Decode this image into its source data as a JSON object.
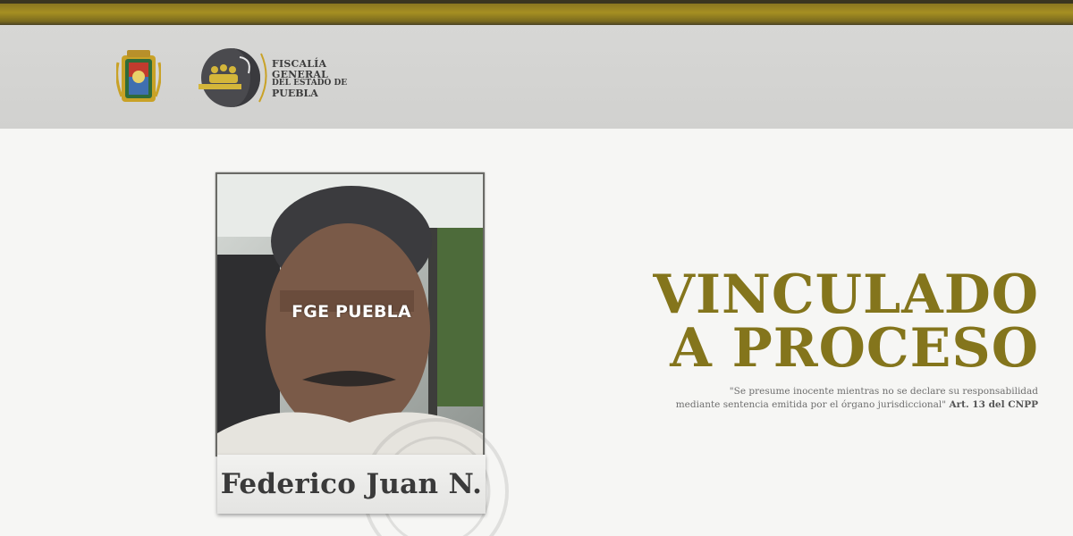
{
  "header": {
    "agency_line1": "FISCALÍA GENERAL",
    "agency_line2": "DEL ESTADO DE",
    "agency_line3": "PUEBLA",
    "seal_icon": "state-coat-of-arms-icon",
    "logo_icon": "fge-logo-icon"
  },
  "photo": {
    "overlay_text": "FGE PUEBLA"
  },
  "person": {
    "name": "Federico Juan N."
  },
  "headline": {
    "line1": "VINCULADO",
    "line2": "A PROCESO"
  },
  "notice": {
    "quote_line1": "\"Se presume inocente mientras no se declare su responsabilidad",
    "quote_line2": "mediante sentencia emitida por el órgano jurisdiccional\"",
    "citation": "Art. 13 del CNPP"
  },
  "colors": {
    "accent_gold": "#84751c",
    "header_gray": "#d4d4d2",
    "stripe_gold": "#a68f22"
  }
}
